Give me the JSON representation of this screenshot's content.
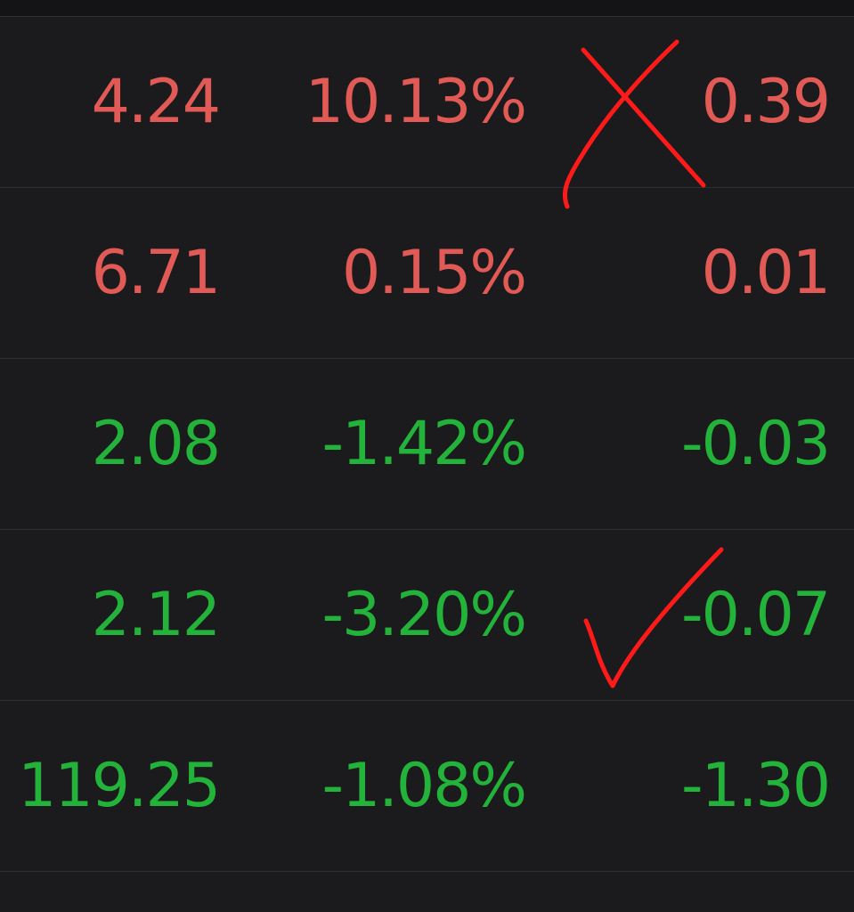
{
  "colors": {
    "background": "#1b1b1d",
    "gain": "#e25a56",
    "loss": "#23b33a",
    "annotation": "#ff1a1a"
  },
  "rows": [
    {
      "price": "4.24",
      "change_pct": "10.13%",
      "change": "0.39",
      "direction": "up"
    },
    {
      "price": "6.71",
      "change_pct": "0.15%",
      "change": "0.01",
      "direction": "up"
    },
    {
      "price": "2.08",
      "change_pct": "-1.42%",
      "change": "-0.03",
      "direction": "down"
    },
    {
      "price": "2.12",
      "change_pct": "-3.20%",
      "change": "-0.07",
      "direction": "down"
    },
    {
      "price": "119.25",
      "change_pct": "-1.08%",
      "change": "-1.30",
      "direction": "down"
    }
  ],
  "annotations": {
    "cross": "cross-mark-icon",
    "check": "check-mark-icon"
  }
}
